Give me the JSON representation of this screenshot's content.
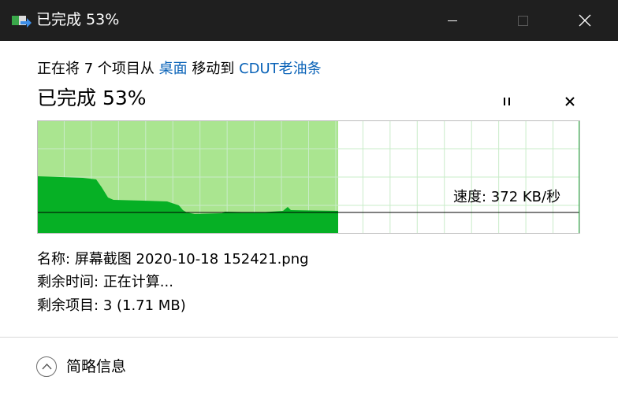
{
  "window": {
    "title": "已完成 53%"
  },
  "header": {
    "desc_prefix": "正在将 7 个项目从 ",
    "source": "桌面",
    "desc_middle": " 移动到 ",
    "destination": "CDUT老油条",
    "progress_title": "已完成 53%"
  },
  "progress": {
    "percent": 53
  },
  "graph": {
    "speed_label": "速度: 372 KB/秒"
  },
  "details": {
    "name_label": "名称:",
    "name_value": "屏幕截图 2020-10-18 152421.png",
    "time_label": "剩余时间:",
    "time_value": "正在计算...",
    "items_label": "剩余项目:",
    "items_value": "3 (1.71 MB)"
  },
  "footer": {
    "toggle_label": "简略信息"
  },
  "colors": {
    "progress_fill": "#aae590",
    "speed_fill": "#06b025",
    "grid": "#c9ecc9",
    "link": "#0a63b8"
  }
}
